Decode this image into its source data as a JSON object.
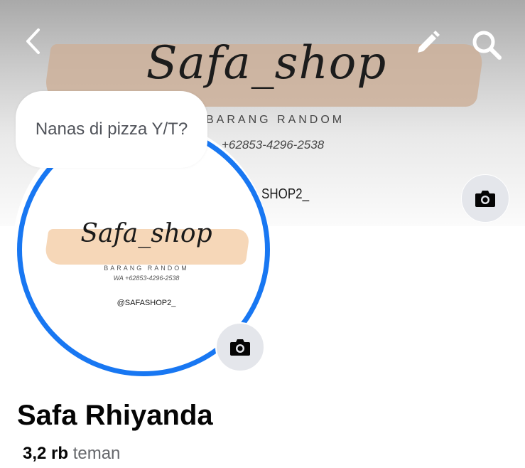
{
  "cover": {
    "title": "Safa_shop",
    "subtitle": "BARANG RANDOM",
    "whatsapp": "+62853-4296-2538",
    "handle": "SHOP2_"
  },
  "header_icons": {
    "back": "chevron-left-icon",
    "edit": "pencil-icon",
    "search": "search-icon",
    "camera": "camera-icon"
  },
  "avatar": {
    "title": "Safa_shop",
    "subtitle": "BARANG RANDOM",
    "whatsapp": "WA +62853-4296-2538",
    "handle": "@SAFASHOP2_"
  },
  "note": {
    "text": "Nanas di pizza Y/T?"
  },
  "profile": {
    "name": "Safa Rhiyanda",
    "friends_count": "3,2 rb",
    "friends_label": "teman"
  },
  "colors": {
    "accent": "#1877f2",
    "button_bg": "#e4e6eb",
    "secondary_text": "#65676b"
  }
}
